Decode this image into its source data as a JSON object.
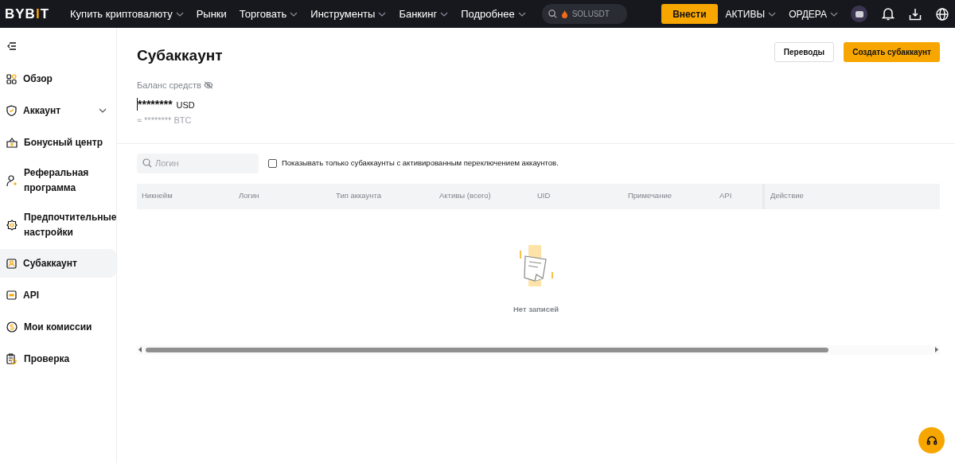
{
  "topbar": {
    "logo": {
      "before": "BYB",
      "accent": "I",
      "after": "T"
    },
    "nav": [
      {
        "label": "Купить криптовалюту",
        "dropdown": true
      },
      {
        "label": "Рынки",
        "dropdown": false
      },
      {
        "label": "Торговать",
        "dropdown": true
      },
      {
        "label": "Инструменты",
        "dropdown": true
      },
      {
        "label": "Банкинг",
        "dropdown": true
      },
      {
        "label": "Подробнее",
        "dropdown": true
      }
    ],
    "search": {
      "placeholder": "SOLUSDT"
    },
    "deposit_button": "Внести",
    "menus": [
      {
        "label": "АКТИВЫ",
        "dropdown": true
      },
      {
        "label": "ОРДЕРА",
        "dropdown": true
      }
    ]
  },
  "sidebar": {
    "items": [
      {
        "label": "Обзор",
        "kind": "link",
        "selected": false
      },
      {
        "label": "Аккаунт",
        "kind": "group",
        "selected": false
      },
      {
        "label": "Бонусный центр",
        "kind": "link",
        "selected": false
      },
      {
        "label": "Реферальная программа",
        "kind": "link",
        "selected": false
      },
      {
        "label": "Предпочтительные настройки",
        "kind": "link",
        "selected": false
      },
      {
        "label": "Субаккаунт",
        "kind": "link",
        "selected": true
      },
      {
        "label": "API",
        "kind": "link",
        "selected": false
      },
      {
        "label": "Мои комиссии",
        "kind": "link",
        "selected": false
      },
      {
        "label": "Проверка",
        "kind": "link",
        "selected": false
      }
    ]
  },
  "page": {
    "title": "Субаккаунт",
    "buttons": [
      {
        "label": "Переводы",
        "kind": "secondary"
      },
      {
        "label": "Создать субаккаунт",
        "kind": "primary"
      }
    ],
    "balance": {
      "label": "Баланс средств",
      "amount": "********",
      "currency": "USD",
      "approx": "≈ ******** BTC"
    },
    "filter": {
      "placeholder": "Логин",
      "checkbox": {
        "label": "Показывать только субаккаунты с активированным переключением аккаунтов.",
        "checked": false
      }
    },
    "table": {
      "columns": [
        "Никнейм",
        "Логин",
        "Тип аккаунта",
        "Активы (всего)",
        "UID",
        "Примечание",
        "API",
        "Действие"
      ],
      "empty_text": "Нет записей"
    }
  }
}
